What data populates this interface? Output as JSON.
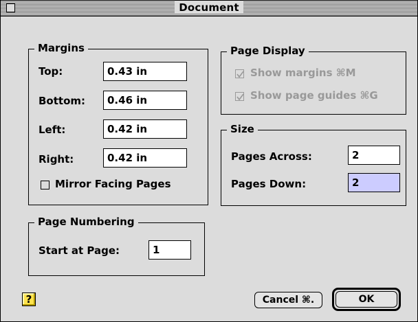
{
  "window": {
    "title": "Document"
  },
  "margins": {
    "group_label": "Margins",
    "top_label": "Top:",
    "top_value": "0.43 in",
    "bottom_label": "Bottom:",
    "bottom_value": "0.46 in",
    "left_label": "Left:",
    "left_value": "0.42 in",
    "right_label": "Right:",
    "right_value": "0.42 in",
    "mirror_label": "Mirror Facing Pages",
    "mirror_checked": false
  },
  "page_display": {
    "group_label": "Page Display",
    "show_margins_label": "Show margins ⌘M",
    "show_margins_checked": true,
    "show_guides_label": "Show page guides ⌘G",
    "show_guides_checked": true
  },
  "size": {
    "group_label": "Size",
    "pages_across_label": "Pages Across:",
    "pages_across_value": "2",
    "pages_down_label": "Pages Down:",
    "pages_down_value": "2"
  },
  "page_numbering": {
    "group_label": "Page Numbering",
    "start_label": "Start at Page:",
    "start_value": "1"
  },
  "buttons": {
    "help_label": "?",
    "cancel_label": "Cancel ⌘.",
    "ok_label": "OK"
  },
  "colors": {
    "selection": "#ccccff",
    "help_button": "#ffe34d"
  }
}
